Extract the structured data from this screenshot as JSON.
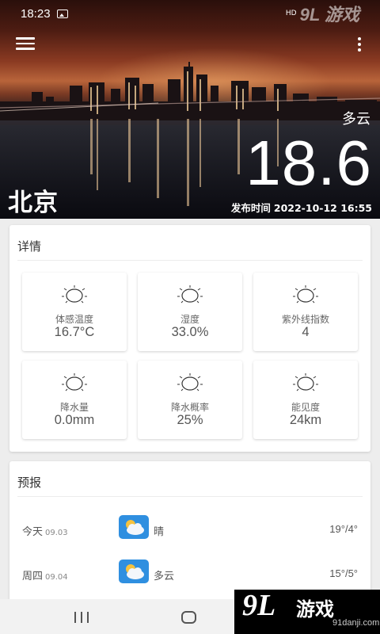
{
  "status_bar": {
    "time": "18:23",
    "right_overlay": "9L 游戏",
    "right_url": "91danji.com",
    "hd": "HD"
  },
  "header": {
    "condition": "多云",
    "temperature": "18.6",
    "city": "北京",
    "publish_label": "发布时间",
    "publish_time": "2022-10-12 16:55"
  },
  "details": {
    "title": "详情",
    "items": [
      {
        "label": "体感温度",
        "value": "16.7°C",
        "icon": "sun-icon"
      },
      {
        "label": "湿度",
        "value": "33.0%",
        "icon": "sun-icon"
      },
      {
        "label": "紫外线指数",
        "value": "4",
        "icon": "sun-icon"
      },
      {
        "label": "降水量",
        "value": "0.0mm",
        "icon": "sun-icon"
      },
      {
        "label": "降水概率",
        "value": "25%",
        "icon": "sun-icon"
      },
      {
        "label": "能见度",
        "value": "24km",
        "icon": "sun-icon"
      }
    ]
  },
  "forecast": {
    "title": "预报",
    "rows": [
      {
        "day": "今天",
        "date": "09.03",
        "weather": "晴",
        "range": "19°/4°",
        "icon": "partly-cloudy-icon"
      },
      {
        "day": "周四",
        "date": "09.04",
        "weather": "多云",
        "range": "15°/5°",
        "icon": "partly-cloudy-icon"
      }
    ]
  },
  "watermark": {
    "number": "9L",
    "text": "游戏",
    "url": "91danji.com"
  },
  "colors": {
    "accent_blue": "#2f8fe0",
    "sun_yellow": "#f6c23e"
  }
}
